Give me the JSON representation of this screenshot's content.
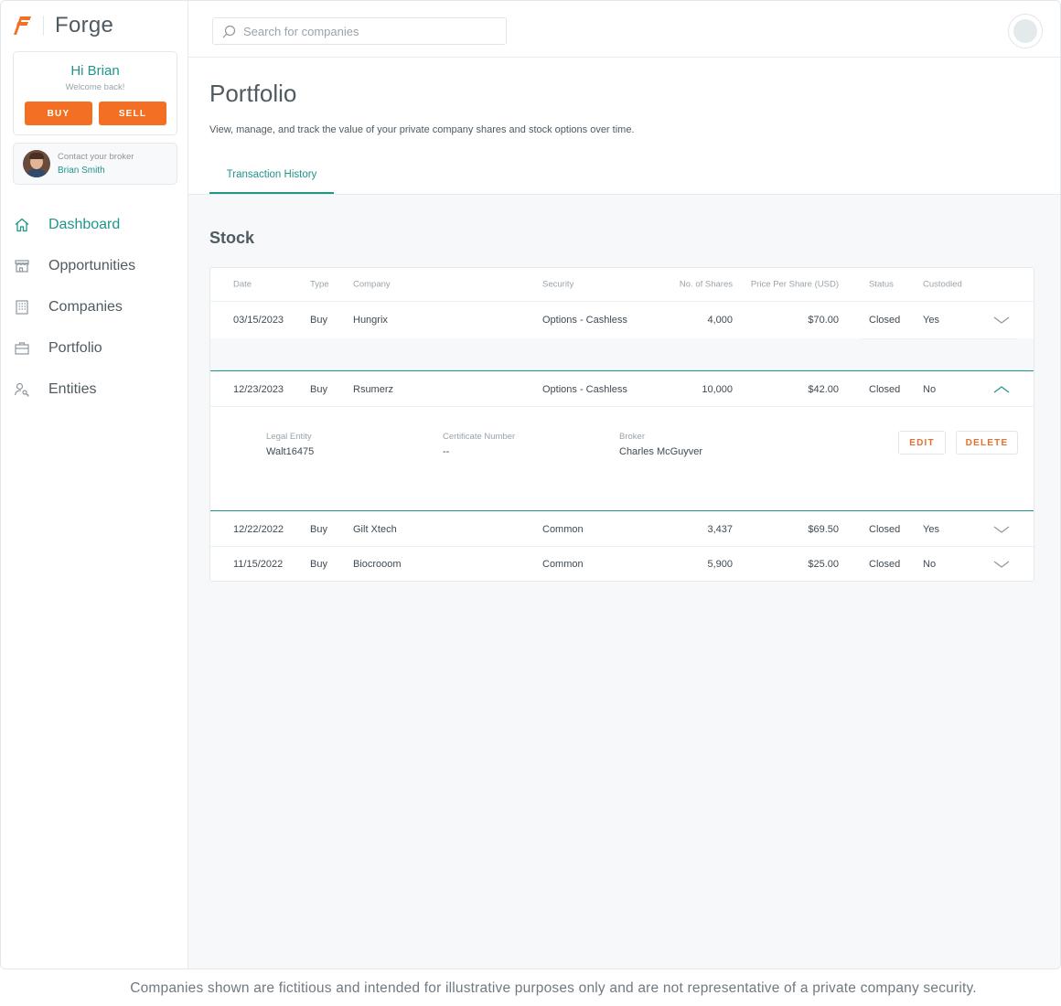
{
  "brand": {
    "name": "Forge",
    "accent": "#f26f24",
    "teal": "#20958a"
  },
  "welcome": {
    "greeting": "Hi Brian",
    "subtitle": "Welcome back!",
    "buy_label": "BUY",
    "sell_label": "SELL"
  },
  "broker": {
    "label": "Contact your broker",
    "name": "Brian Smith"
  },
  "nav": [
    {
      "label": "Dashboard",
      "icon": "home-icon",
      "active": true
    },
    {
      "label": "Opportunities",
      "icon": "storefront-icon",
      "active": false
    },
    {
      "label": "Companies",
      "icon": "building-icon",
      "active": false
    },
    {
      "label": "Portfolio",
      "icon": "briefcase-icon",
      "active": false
    },
    {
      "label": "Entities",
      "icon": "user-key-icon",
      "active": false
    }
  ],
  "search": {
    "placeholder": "Search for companies",
    "value": ""
  },
  "page": {
    "title": "Portfolio",
    "description": "View, manage, and track the value of your private company shares and stock options over time.",
    "tab": "Transaction History"
  },
  "stock": {
    "title": "Stock",
    "columns": {
      "date": "Date",
      "type": "Type",
      "company": "Company",
      "security": "Security",
      "shares": "No. of Shares",
      "price": "Price Per Share (USD)",
      "status": "Status",
      "custodied": "Custodied"
    },
    "rows": [
      {
        "date": "03/15/2023",
        "type": "Buy",
        "company": "Hungrix",
        "security": "Options - Cashless",
        "shares": "4,000",
        "price": "$70.00",
        "status": "Closed",
        "custodied": "Yes",
        "expanded": false
      },
      {
        "date": "12/23/2023",
        "type": "Buy",
        "company": "Rsumerz",
        "security": "Options - Cashless",
        "shares": "10,000",
        "price": "$42.00",
        "status": "Closed",
        "custodied": "No",
        "expanded": true
      },
      {
        "date": "12/22/2022",
        "type": "Buy",
        "company": "Gilt Xtech",
        "security": "Common",
        "shares": "3,437",
        "price": "$69.50",
        "status": "Closed",
        "custodied": "Yes",
        "expanded": false
      },
      {
        "date": "11/15/2022",
        "type": "Buy",
        "company": "Biocrooom",
        "security": "Common",
        "shares": "5,900",
        "price": "$25.00",
        "status": "Closed",
        "custodied": "No",
        "expanded": false
      }
    ],
    "detail": {
      "legal_entity_label": "Legal Entity",
      "legal_entity": "Walt16475",
      "certificate_label": "Certificate Number",
      "certificate": "--",
      "broker_label": "Broker",
      "broker": "Charles McGuyver",
      "edit_label": "EDIT",
      "delete_label": "DELETE"
    }
  },
  "disclaimer": "Companies shown are fictitious and intended for illustrative purposes only and are not representative of a private company security."
}
